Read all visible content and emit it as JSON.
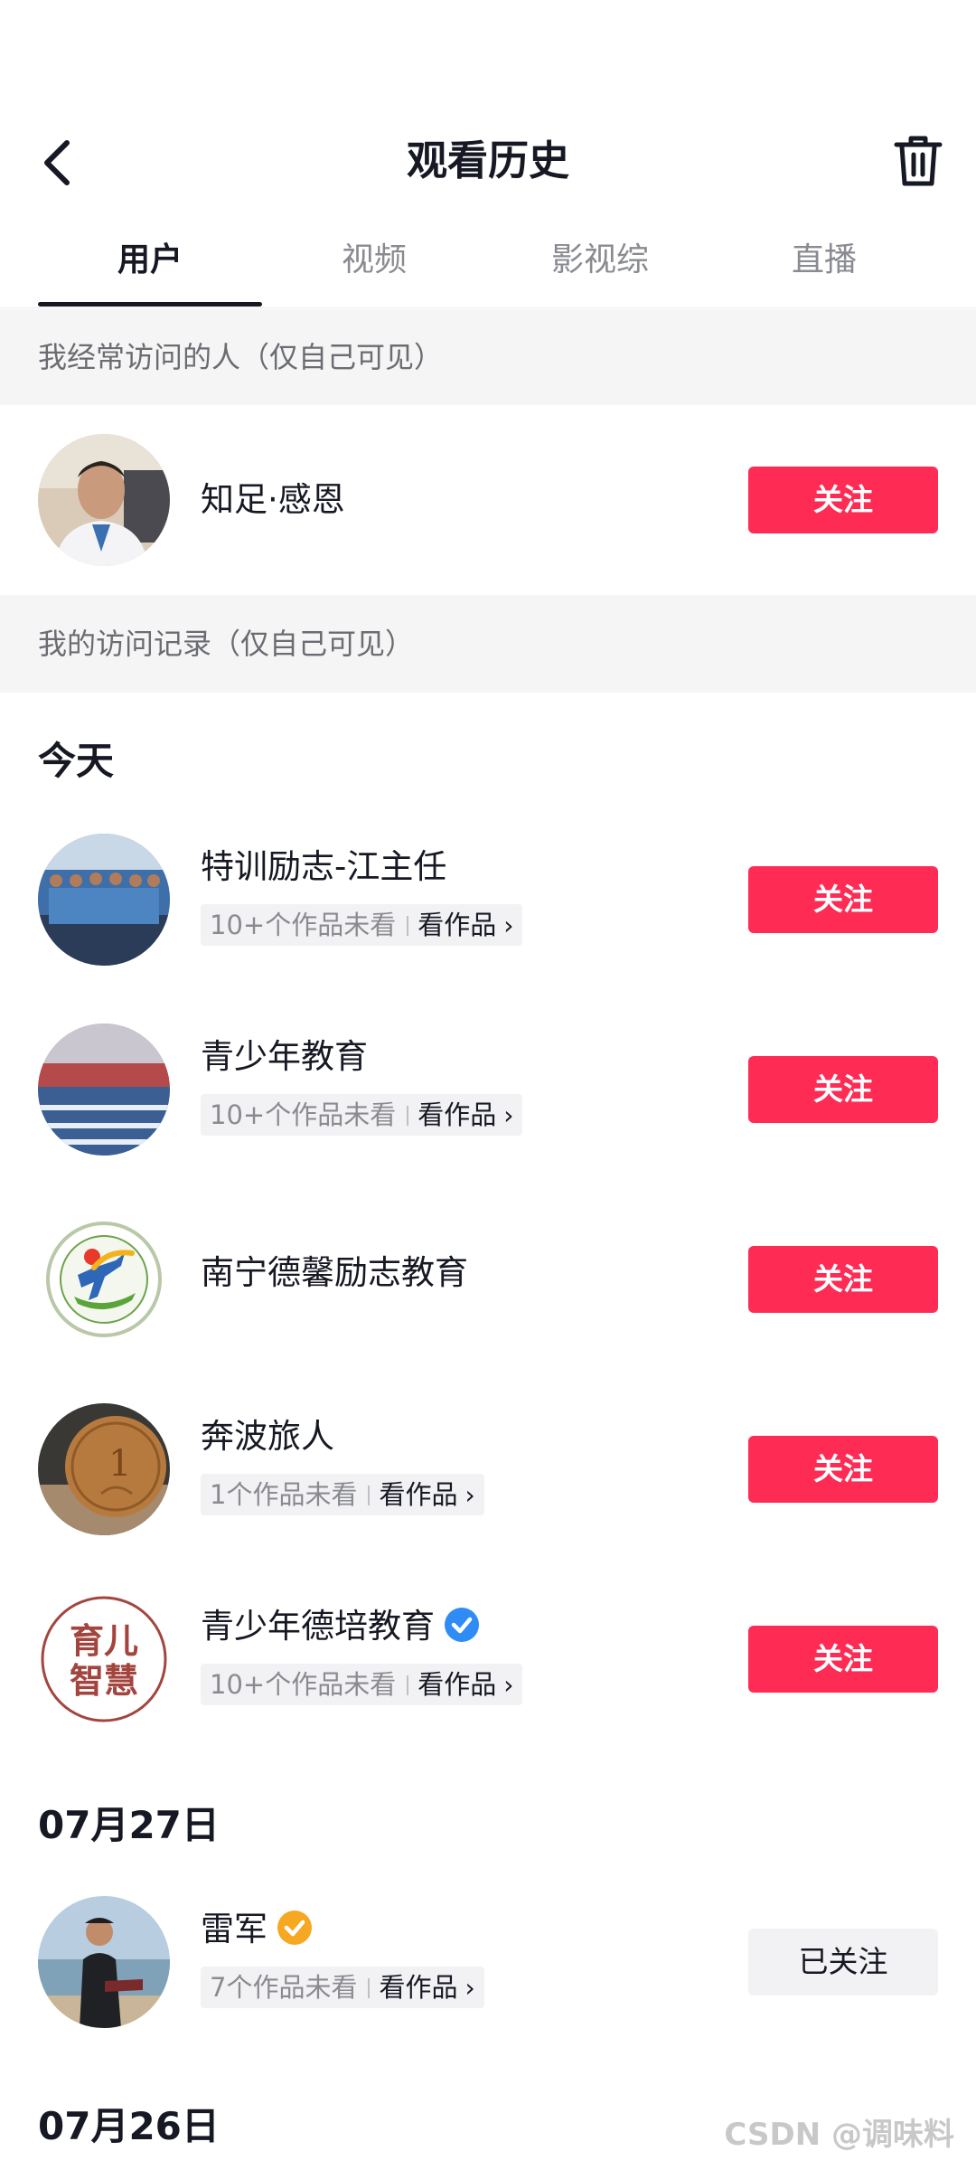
{
  "header": {
    "title": "观看历史",
    "back_icon": "chevron-left-icon",
    "trash_icon": "trash-icon"
  },
  "tabs": [
    {
      "label": "用户",
      "active": true
    },
    {
      "label": "视频",
      "active": false
    },
    {
      "label": "影视综",
      "active": false
    },
    {
      "label": "直播",
      "active": false
    }
  ],
  "frequent": {
    "heading": "我经常访问的人（仅自己可见）",
    "user": {
      "name": "知足·感恩",
      "button": "关注"
    }
  },
  "history": {
    "heading": "我的访问记录（仅自己可见）",
    "groups": [
      {
        "date": "今天",
        "users": [
          {
            "name": "特训励志-江主任",
            "unseen": "10+个作品未看",
            "link": "看作品",
            "button": "关注"
          },
          {
            "name": "青少年教育",
            "unseen": "10+个作品未看",
            "link": "看作品",
            "button": "关注"
          },
          {
            "name": "南宁德馨励志教育",
            "button": "关注"
          },
          {
            "name": "奔波旅人",
            "unseen": "1个作品未看",
            "link": "看作品",
            "button": "关注"
          },
          {
            "name": "青少年德培教育",
            "unseen": "10+个作品未看",
            "link": "看作品",
            "button": "关注",
            "badge": "blue-verified-icon"
          }
        ]
      },
      {
        "date": "07月27日",
        "users": [
          {
            "name": "雷军",
            "unseen": "7个作品未看",
            "link": "看作品",
            "button": "已关注",
            "badge": "orange-verified-icon"
          }
        ]
      },
      {
        "date": "07月26日",
        "users": []
      }
    ]
  },
  "avatar5_text": {
    "line1": "育儿",
    "line2": "智慧"
  },
  "avatar4_text": {
    "coin": "1"
  },
  "watermark": "CSDN @调味料",
  "colors": {
    "follow": "#fe2c55",
    "text": "#161823",
    "muted": "#8a8b91",
    "section_bg": "#f5f5f5"
  }
}
